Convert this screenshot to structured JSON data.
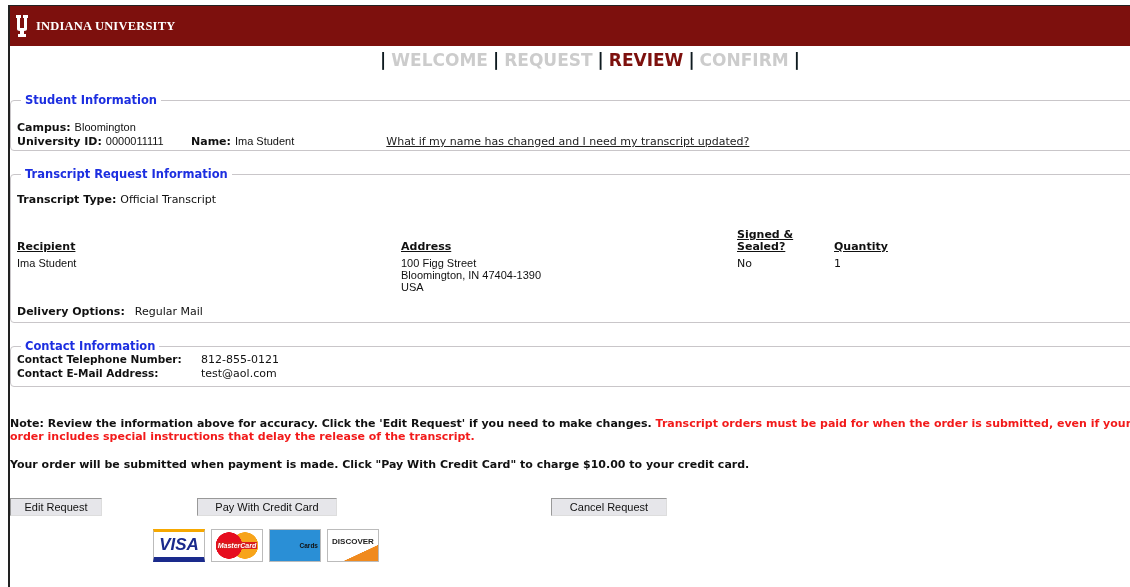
{
  "header": {
    "title": "INDIANA UNIVERSITY"
  },
  "steps": [
    {
      "kind": "separator",
      "label": "|"
    },
    {
      "kind": "step",
      "label": "WELCOME",
      "selected": false
    },
    {
      "kind": "separator",
      "label": "|"
    },
    {
      "kind": "step",
      "label": "REQUEST",
      "selected": false
    },
    {
      "kind": "separator",
      "label": "|"
    },
    {
      "kind": "step",
      "label": "REVIEW",
      "selected": true
    },
    {
      "kind": "separator",
      "label": "|"
    },
    {
      "kind": "step",
      "label": "CONFIRM",
      "selected": false
    },
    {
      "kind": "separator",
      "label": "|"
    }
  ],
  "student_information": {
    "legend": "Student Information",
    "campus_label": "Campus:",
    "campus": "Bloomington",
    "id_label": "University ID:",
    "id": "0000011111",
    "name_label": "Name:",
    "name": "Ima Student",
    "link": "What if my name has changed and I need my transcript updated?"
  },
  "transcript_request": {
    "legend": "Transcript Request Information",
    "type_label": "Transcript Type:",
    "type": "Official Transcript",
    "columns": [
      "Recipient",
      "Address",
      "Signed & Sealed?",
      "Quantity"
    ],
    "row": {
      "recipient": "Ima Student",
      "address": [
        "100 Figg Street",
        "Bloomington, IN 47404-1390",
        "USA"
      ],
      "signed_sealed": "No",
      "quantity": "1"
    },
    "delivery_label": "Delivery Options:",
    "delivery": "Regular Mail"
  },
  "contact_information": {
    "legend": "Contact Information",
    "phone_label": "Contact Telephone Number:",
    "phone": "812-855-0121",
    "email_label": "Contact E-Mail Address:",
    "email": "test@aol.com"
  },
  "note": "Note: Review the information above for accuracy. Click the 'Edit Request' if you need to make changes.",
  "warning_lines": [
    "Transcript orders must be paid for when the order is submitted, even if your",
    "order includes special instructions that delay the release of the transcript."
  ],
  "payment_note": "Your order will be submitted when payment is made. Click \"Pay With Credit Card\" to charge $10.00 to your credit card.",
  "buttons": [
    "Edit Request",
    "Pay With Credit Card",
    "Cancel Request"
  ],
  "cards": [
    {
      "kind": "visa",
      "label": "VISA"
    },
    {
      "kind": "mastercard",
      "label": "MasterCard"
    },
    {
      "kind": "amex",
      "label": "Cards"
    },
    {
      "kind": "discover",
      "label": "DISCOVER"
    }
  ]
}
